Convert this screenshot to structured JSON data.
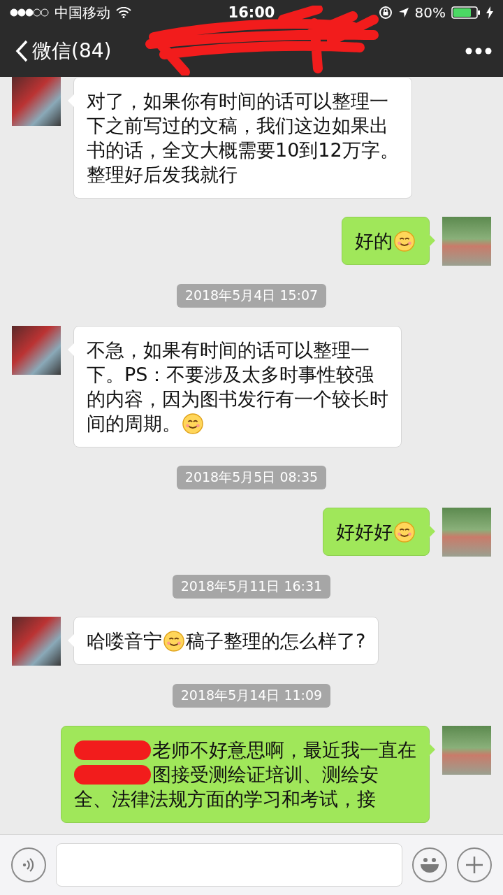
{
  "status_bar": {
    "carrier": "中国移动",
    "time": "16:00",
    "battery": "80%"
  },
  "nav_bar": {
    "back_label": "微信(84)"
  },
  "messages": [
    {
      "kind": "incoming",
      "lines": [
        [
          {
            "kind": "text",
            "text": "对了，如果你有时间的话可以整理一"
          }
        ],
        [
          {
            "kind": "text",
            "text": "下之前写过的文稿，我们这边如果出"
          }
        ],
        [
          {
            "kind": "text",
            "text": "书的话，全文大概需要10到12万字。"
          }
        ],
        [
          {
            "kind": "text",
            "text": "整理好后发我就行"
          }
        ]
      ]
    },
    {
      "kind": "outgoing",
      "lines": [
        [
          {
            "kind": "text",
            "text": "好的"
          },
          {
            "kind": "emoji"
          }
        ]
      ]
    },
    {
      "kind": "time",
      "text": "2018年5月4日 15:07"
    },
    {
      "kind": "incoming",
      "lines": [
        [
          {
            "kind": "text",
            "text": "不急，如果有时间的话可以整理一"
          }
        ],
        [
          {
            "kind": "text",
            "text": "下。PS：不要涉及太多时事性较强"
          }
        ],
        [
          {
            "kind": "text",
            "text": "的内容，因为图书发行有一个较长时"
          }
        ],
        [
          {
            "kind": "text",
            "text": "间的周期。"
          },
          {
            "kind": "emoji"
          }
        ]
      ]
    },
    {
      "kind": "time",
      "text": "2018年5月5日 08:35"
    },
    {
      "kind": "outgoing",
      "lines": [
        [
          {
            "kind": "text",
            "text": "好好好"
          },
          {
            "kind": "emoji"
          }
        ]
      ]
    },
    {
      "kind": "time",
      "text": "2018年5月11日 16:31"
    },
    {
      "kind": "incoming",
      "lines": [
        [
          {
            "kind": "text",
            "text": "哈喽音宁"
          },
          {
            "kind": "emoji"
          },
          {
            "kind": "text",
            "text": "稿子整理的怎么样了?"
          }
        ]
      ]
    },
    {
      "kind": "time",
      "text": "2018年5月14日 11:09"
    },
    {
      "kind": "outgoing",
      "lines": [
        [
          {
            "kind": "redaction"
          },
          {
            "kind": "text",
            "text": "老师不好意思啊，最近我一直在"
          }
        ],
        [
          {
            "kind": "redaction"
          },
          {
            "kind": "text",
            "text": "图接受测绘证培训、测绘安"
          }
        ],
        [
          {
            "kind": "text",
            "text": "全、法律法规方面的学习和考试，接"
          }
        ]
      ]
    }
  ]
}
